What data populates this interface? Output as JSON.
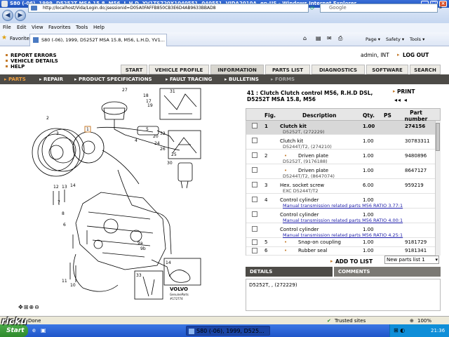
{
  "window": {
    "title": "S80 (-06), 1999, D5252T MSA 15.8, M56, L.H.D, YV1TS720X1040551, 040551, VIDA2010A, en-US - Windows Internet Explorer"
  },
  "browser": {
    "url": "http://localhost/Vida/Login.do;jsessionid=D05A0FAFFB850CB3E6D4AB9633BBAD8",
    "search_placeholder": "Google",
    "menu": [
      "File",
      "Edit",
      "View",
      "Favorites",
      "Tools",
      "Help"
    ],
    "favorites_label": "Favorites",
    "tab_title": "S80 (-06), 1999, D5252T MSA 15.8, M56, L.H.D, YV1...",
    "toolbar_items": [
      "Page ▾",
      "Safety ▾",
      "Tools ▾"
    ]
  },
  "app": {
    "top_links": [
      "REPORT ERRORS",
      "VEHICLE DETAILS",
      "HELP"
    ],
    "user": "admin, INT",
    "logout": "LOG OUT",
    "nav_tabs": [
      "START",
      "VEHICLE PROFILE",
      "INFORMATION",
      "PARTS LIST",
      "DIAGNOSTICS",
      "SOFTWARE",
      "SEARCH"
    ],
    "sub_nav": [
      "PARTS",
      "REPAIR",
      "PRODUCT SPECIFICATIONS",
      "FAULT TRACING",
      "BULLETINS",
      "FORMS"
    ]
  },
  "diagram": {
    "callouts": [
      "27",
      "1",
      "2",
      "4",
      "12",
      "13",
      "14",
      "9a",
      "9b",
      "10",
      "11",
      "25",
      "26",
      "30",
      "31",
      "32",
      "33",
      "17",
      "18",
      "19",
      "20",
      "24",
      "6",
      "7",
      "8",
      "3",
      "5",
      "14"
    ],
    "logo": "VOLVO",
    "logo_sub": "GenuineParts",
    "code": "#172774"
  },
  "parts": {
    "title": "41 : Clutch Clutch control M56, R.H.D DSL, D5252T MSA 15.8, M56",
    "print": "PRINT",
    "nav_arrows": "◂◂ ◂",
    "headers": {
      "fig": "Fig.",
      "desc": "Description",
      "qty": "Qty.",
      "ps": "PS",
      "part": "Part number"
    },
    "rows": [
      {
        "fig": "1",
        "desc": "Clutch kit",
        "sub": "D5252T, (272229)",
        "qty": "1.00",
        "part": "274156",
        "selected": true,
        "bullet": false,
        "link": false
      },
      {
        "fig": "",
        "desc": "Clutch kit",
        "sub": "D5244T/T2, (274210)",
        "qty": "1.00",
        "part": "30783311",
        "selected": false,
        "bullet": false,
        "link": false
      },
      {
        "fig": "2",
        "desc": "Driven plate",
        "sub": "D5252T, (9176188)",
        "qty": "1.00",
        "part": "9480896",
        "selected": false,
        "bullet": true,
        "link": false
      },
      {
        "fig": "",
        "desc": "Driven plate",
        "sub": "D5244T/T2, (8647074)",
        "qty": "1.00",
        "part": "8647127",
        "selected": false,
        "bullet": true,
        "link": false
      },
      {
        "fig": "3",
        "desc": "Hex. socket screw",
        "sub": "EXC D5244T/T2",
        "qty": "6.00",
        "part": "959219",
        "selected": false,
        "bullet": false,
        "link": false
      },
      {
        "fig": "4",
        "desc": "Control cylinder",
        "sub": "Manual transmission related parts M56 RATIO 3.77:1",
        "qty": "1.00",
        "part": "",
        "selected": false,
        "bullet": false,
        "link": true
      },
      {
        "fig": "",
        "desc": "Control cylinder",
        "sub": "Manual transmission related parts M56 RATIO 4.00:1",
        "qty": "1.00",
        "part": "",
        "selected": false,
        "bullet": false,
        "link": true
      },
      {
        "fig": "",
        "desc": "Control cylinder",
        "sub": "Manual transmission related parts M56 RATIO 4.25:1",
        "qty": "1.00",
        "part": "",
        "selected": false,
        "bullet": false,
        "link": true
      },
      {
        "fig": "5",
        "desc": "Snap-on coupling",
        "sub": "",
        "qty": "1.00",
        "part": "9181729",
        "selected": false,
        "bullet": true,
        "link": false
      },
      {
        "fig": "6",
        "desc": "Rubber seal",
        "sub": "",
        "qty": "1.00",
        "part": "9181341",
        "selected": false,
        "bullet": true,
        "link": false
      }
    ],
    "add_to_list": "ADD TO LIST",
    "list_select": "New parts list 1",
    "bottom_tabs": [
      "DETAILS",
      "COMMENTS"
    ],
    "details_text": "D5252T, , (272229)"
  },
  "status": {
    "done": "Done",
    "zone": "Trusted sites",
    "zoom": "100%"
  },
  "taskbar": {
    "start": "Start",
    "task": "S80 (-06), 1999, D525...",
    "time": "21:36"
  },
  "watermark": "ricku"
}
